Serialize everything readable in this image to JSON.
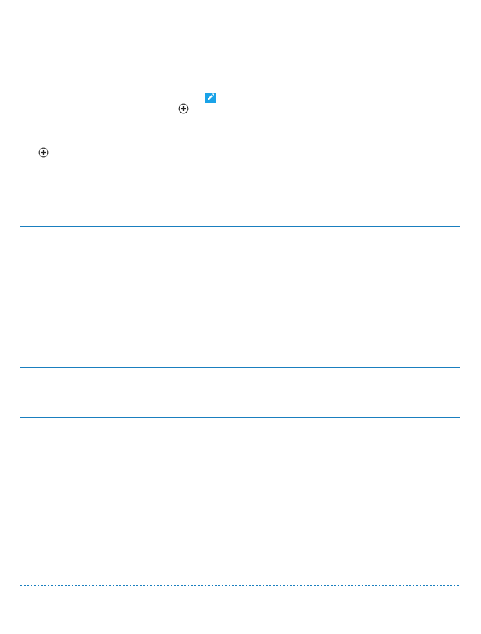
{
  "icons": {
    "plus_a": "add-circle-icon",
    "plus_b": "add-circle-icon",
    "edit": "edit-tile-icon"
  },
  "colors": {
    "accent": "#1aa3e8",
    "rule": "#1a7fbf",
    "icon_stroke": "#222222"
  }
}
